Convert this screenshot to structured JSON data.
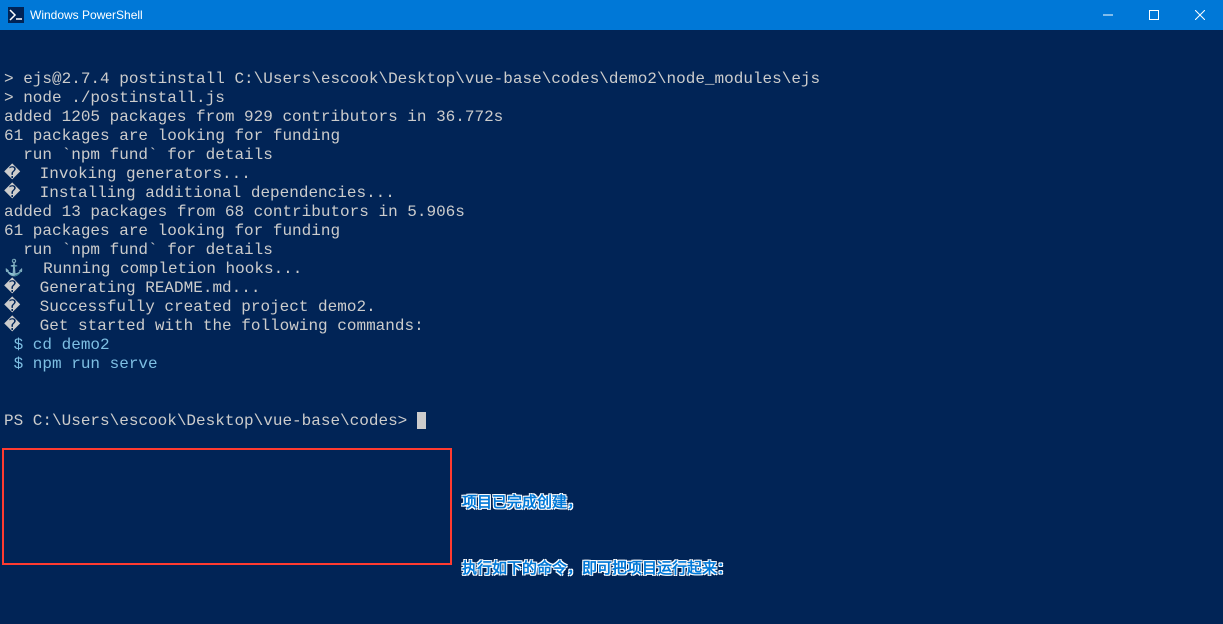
{
  "titlebar": {
    "title": "Windows PowerShell",
    "icon_label": ">_"
  },
  "terminal": {
    "lines": [
      {
        "text": "> ejs@2.7.4 postinstall C:\\Users\\escook\\Desktop\\vue-base\\codes\\demo2\\node_modules\\ejs",
        "cls": ""
      },
      {
        "text": "> node ./postinstall.js",
        "cls": ""
      },
      {
        "text": "",
        "cls": ""
      },
      {
        "text": "added 1205 packages from 929 contributors in 36.772s",
        "cls": ""
      },
      {
        "text": "",
        "cls": ""
      },
      {
        "text": "61 packages are looking for funding",
        "cls": ""
      },
      {
        "text": "  run `npm fund` for details",
        "cls": ""
      },
      {
        "text": "",
        "cls": ""
      },
      {
        "text": "�  Invoking generators...",
        "cls": ""
      },
      {
        "text": "�  Installing additional dependencies...",
        "cls": ""
      },
      {
        "text": "",
        "cls": ""
      },
      {
        "text": "added 13 packages from 68 contributors in 5.906s",
        "cls": ""
      },
      {
        "text": "",
        "cls": ""
      },
      {
        "text": "61 packages are looking for funding",
        "cls": ""
      },
      {
        "text": "  run `npm fund` for details",
        "cls": ""
      },
      {
        "text": "",
        "cls": ""
      },
      {
        "text": "⚓  Running completion hooks...",
        "cls": ""
      },
      {
        "text": "",
        "cls": ""
      },
      {
        "text": "�  Generating README.md...",
        "cls": ""
      },
      {
        "text": "",
        "cls": ""
      },
      {
        "text": "�  Successfully created project demo2.",
        "cls": ""
      },
      {
        "text": "�  Get started with the following commands:",
        "cls": ""
      },
      {
        "text": "",
        "cls": ""
      },
      {
        "text": " $ cd demo2",
        "cls": "cyan"
      },
      {
        "text": " $ npm run serve",
        "cls": "cyan"
      },
      {
        "text": "",
        "cls": ""
      }
    ],
    "prompt": "PS C:\\Users\\escook\\Desktop\\vue-base\\codes> "
  },
  "annotation": {
    "line1": "项目已完成创建，",
    "line2": "执行如下的命令，即可把项目运行起来："
  }
}
